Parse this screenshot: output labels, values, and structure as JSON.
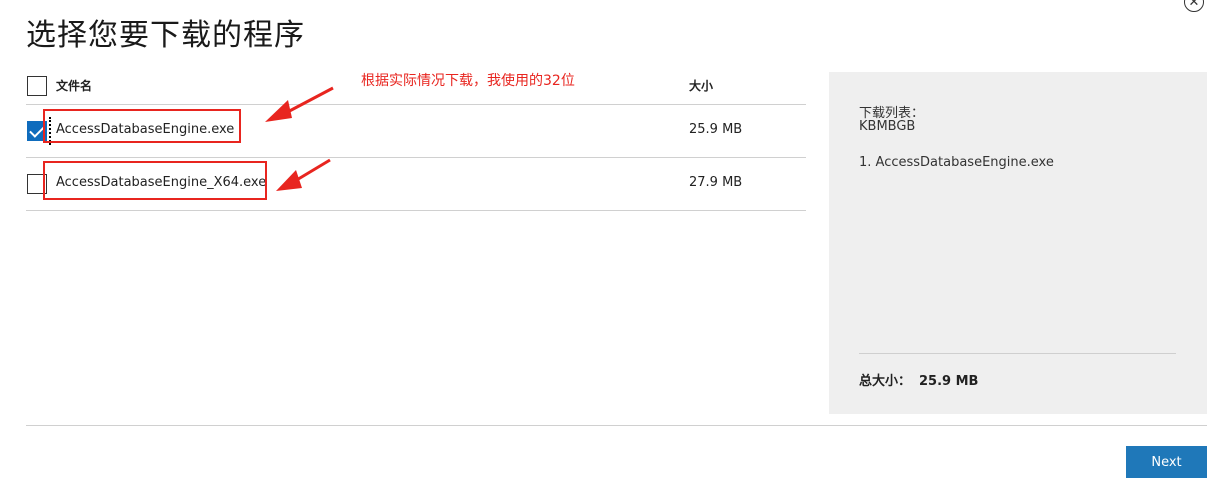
{
  "page": {
    "title": "选择您要下载的程序",
    "close_icon": "close-icon"
  },
  "table": {
    "header": {
      "name": "文件名",
      "size": "大小"
    },
    "rows": [
      {
        "name": "AccessDatabaseEngine.exe",
        "size": "25.9 MB",
        "checked": true
      },
      {
        "name": "AccessDatabaseEngine_X64.exe",
        "size": "27.9 MB",
        "checked": false
      }
    ]
  },
  "annotation": {
    "text": "根据实际情况下载，我使用的32位",
    "color": "#e8251f"
  },
  "side": {
    "title": "下载列表：",
    "sub": "KBMBGB",
    "items": [
      "1. AccessDatabaseEngine.exe"
    ],
    "total_label": "总大小：",
    "total_value": "25.9 MB"
  },
  "actions": {
    "next_label": "Next",
    "accent": "#1f78b9"
  }
}
